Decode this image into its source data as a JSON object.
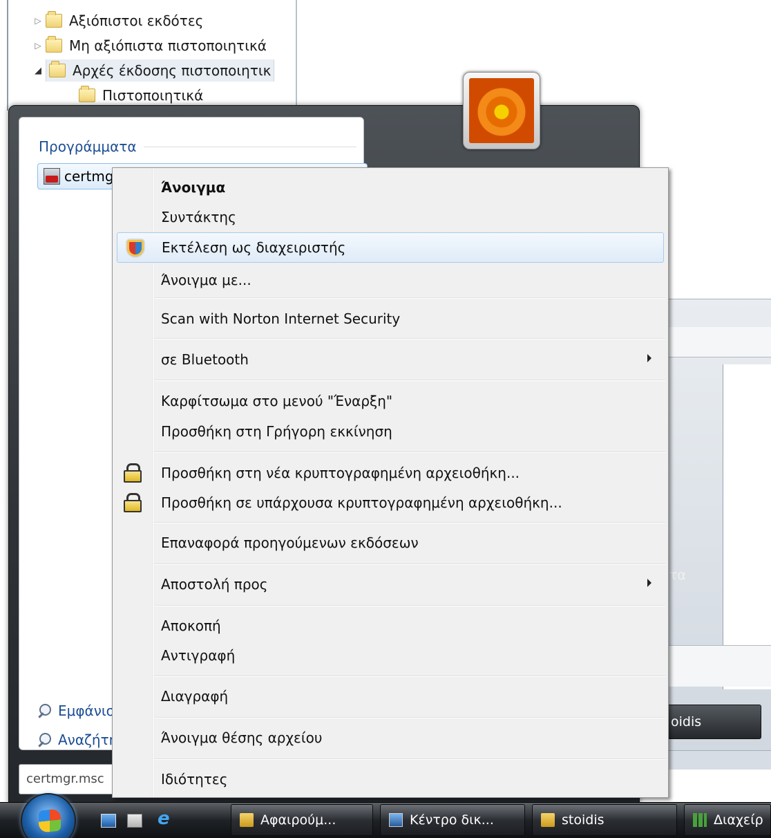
{
  "tree": {
    "items": [
      {
        "label": "Αξιόπιστοι εκδότες",
        "expanded": false
      },
      {
        "label": "Μη αξιόπιστα πιστοποιητικά",
        "expanded": false
      },
      {
        "label": "Αρχές έκδοσης πιστοποιητικ",
        "expanded": true
      },
      {
        "label": "Πιστοποιητικά",
        "child": true
      }
    ]
  },
  "start_menu": {
    "programs_header": "Προγράμματα",
    "program_item": "certmgr",
    "search_links": [
      "Εμφάνισ",
      "Αναζήτη"
    ],
    "search_value": "certmgr.msc",
    "peek_label": "τα"
  },
  "background_window": {
    "button_label": "oidis"
  },
  "context_menu": {
    "items": [
      {
        "label": "Άνοιγμα",
        "bold": true
      },
      {
        "label": "Συντάκτης"
      },
      {
        "label": "Εκτέλεση ως διαχειριστής",
        "icon": "shield-icon",
        "hover": true
      },
      {
        "label": "Άνοιγμα με..."
      },
      {
        "label": "Scan with Norton Internet Security"
      },
      {
        "label": "σε Bluetooth",
        "submenu": true
      },
      {
        "label": "Καρφίτσωμα στο μενού \"Έναρξη\""
      },
      {
        "label": "Προσθήκη στη Γρήγορη εκκίνηση"
      },
      {
        "label": "Προσθήκη στη νέα κρυπτογραφημένη αρχειοθήκη...",
        "icon": "lock-icon"
      },
      {
        "label": "Προσθήκη σε υπάρχουσα κρυπτογραφημένη αρχειοθήκη...",
        "icon": "lock-icon"
      },
      {
        "label": "Επαναφορά προηγούμενων εκδόσεων"
      },
      {
        "label": "Αποστολή προς",
        "submenu": true
      },
      {
        "label": "Αποκοπή"
      },
      {
        "label": "Αντιγραφή"
      },
      {
        "label": "Διαγραφή"
      },
      {
        "label": "Άνοιγμα θέσης αρχείου"
      },
      {
        "label": "Ιδιότητες"
      }
    ]
  },
  "taskbar": {
    "buttons": [
      {
        "label": "Αφαιρούμ...",
        "icon": "folder-icon"
      },
      {
        "label": "Κέντρο δικ...",
        "icon": "network-icon"
      },
      {
        "label": "stoidis",
        "icon": "folder-icon"
      },
      {
        "label": "Διαχείρ",
        "icon": "chart-icon"
      }
    ]
  },
  "colors": {
    "accent_blue": "#1b4d95",
    "menu_bg": "#f0f0f0",
    "hover_border": "#a8cbe9"
  }
}
